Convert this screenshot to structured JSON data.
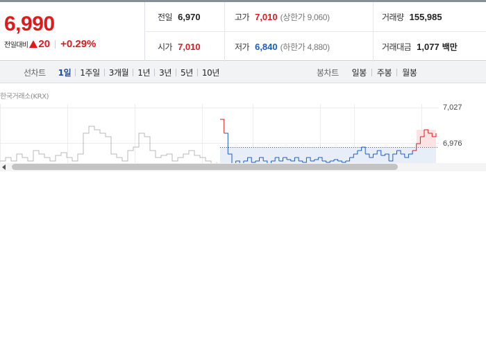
{
  "quote": {
    "current_price": "6,990",
    "change_label": "전일대비",
    "change_direction_icon": "up-triangle-icon",
    "change_value": "20",
    "change_rate": "+0.29%"
  },
  "stats": {
    "prev_close": {
      "label": "전일",
      "value": "6,970"
    },
    "high": {
      "label": "고가",
      "value": "7,010",
      "sub": "(상한가 9,060)"
    },
    "volume": {
      "label": "거래량",
      "value": "155,985"
    },
    "open": {
      "label": "시가",
      "value": "7,010"
    },
    "low": {
      "label": "저가",
      "value": "6,840",
      "sub": "(하한가 4,880)"
    },
    "trade_amount": {
      "label": "거래대금",
      "value": "1,077",
      "unit": "백만"
    }
  },
  "toolbar": {
    "line_chart_label": "선차트",
    "line_periods": [
      "1일",
      "1주일",
      "3개월",
      "1년",
      "3년",
      "5년",
      "10년"
    ],
    "active_period": "1일",
    "candle_chart_label": "봉차트",
    "candle_periods": [
      "일봉",
      "주봉",
      "월봉"
    ]
  },
  "chart": {
    "exchange_label": "한국거래소(KRX)",
    "y_labels": [
      "7,027",
      "6,976"
    ],
    "prev_close_level": 6970,
    "colors": {
      "up": "#e0191d",
      "down": "#1a5cc7",
      "history": "#b8b8b8",
      "fill": "#e8eef8"
    }
  },
  "chart_data": {
    "type": "line",
    "title": "",
    "xlabel": "",
    "ylabel": "",
    "y_ticks": [
      7027,
      6976
    ],
    "reference_line": 6970,
    "series": [
      {
        "values": [
          6950,
          6955,
          6950,
          6960,
          6955,
          6950,
          6965,
          6960,
          6955,
          6950,
          6958,
          6962,
          6955,
          6950,
          6960,
          6990,
          7000,
          6995,
          6990,
          6985,
          6960,
          6955,
          6950,
          6965,
          6970,
          6990,
          6985,
          6965,
          6955,
          6958,
          6960,
          6950,
          6955,
          6960,
          6965,
          6958,
          6955,
          6950,
          6945,
          6948
        ]
      },
      {
        "values": [
          7010,
          6990,
          6960,
          6940,
          6950,
          6945,
          6950,
          6955,
          6948,
          6950,
          6955,
          6950,
          6945,
          6950,
          6955,
          6950,
          6955,
          6952,
          6950,
          6955,
          6950,
          6948,
          6955,
          6950,
          6952,
          6955,
          6950,
          6948,
          6950,
          6952,
          6950,
          6948,
          6950,
          6955,
          6960,
          6965,
          6970,
          6960,
          6955,
          6960,
          6965,
          6958,
          6960,
          6950,
          6960,
          6965,
          6960,
          6955,
          6960,
          6965,
          6975,
          6985,
          6995,
          6990,
          6985,
          6990
        ]
      }
    ]
  }
}
